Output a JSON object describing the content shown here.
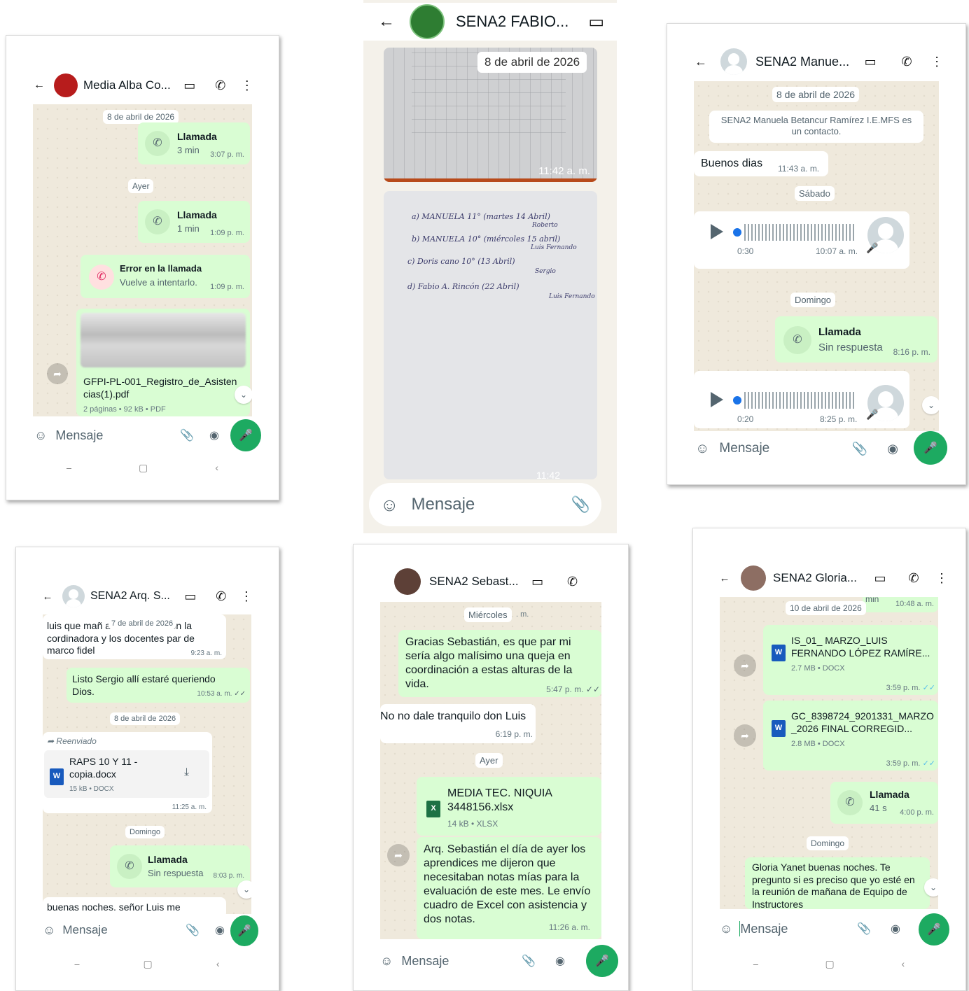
{
  "s1": {
    "title": "Media Alba Co...",
    "date_pill": "8 de abril de 2026",
    "call1": {
      "label": "Llamada",
      "duration": "3 min",
      "time": "3:07 p. m."
    },
    "yesterday_pill": "Ayer",
    "call2": {
      "label": "Llamada",
      "duration": "1 min",
      "time": "1:09 p. m."
    },
    "error": {
      "label": "Error en la llamada",
      "sub": "Vuelve a intentarlo.",
      "time": "1:09 p. m."
    },
    "doc": {
      "name": "GFPI-PL-001_Registro_de_Asistencias(1).pdf",
      "meta": "2 páginas • 92 kB • PDF"
    },
    "placeholder": "Mensaje"
  },
  "s2": {
    "title": "SENA2 FABIO...",
    "date_pill": "8 de abril de 2026",
    "img_time": "11:42 a. m.",
    "img_time2": "11:42",
    "notes": [
      "a) MANUELA   11°   (martes 14 Abril)",
      "Roberto",
      "b) MANUELA   10°   (miércoles 15 abril)",
      "Luis Fernando",
      "c) Doris cano  10°   (13 Abril)",
      "Sergio",
      "d) Fabio A. Rincón  (22 Abril)",
      "Luis Fernando"
    ],
    "placeholder": "Mensaje"
  },
  "s3": {
    "title": "SENA2 Manue...",
    "date_pill": "8 de abril de 2026",
    "contact_note": "SENA2 Manuela Betancur Ramírez I.E.MFS es un contacto.",
    "msg1": {
      "text": "Buenos dias",
      "time": "11:43 a. m."
    },
    "saturday_pill": "Sábado",
    "voice1": {
      "duration": "0:30",
      "time": "10:07 a. m."
    },
    "sunday_pill": "Domingo",
    "call": {
      "label": "Llamada",
      "sub": "Sin respuesta",
      "time": "8:16 p. m."
    },
    "voice2": {
      "duration": "0:20",
      "time": "8:25 p. m."
    },
    "placeholder": "Mensaje"
  },
  "s4": {
    "title": "SENA2 Arq. S...",
    "msg1": {
      "text": "luis que mañ  ara reunirnos con la cordinadora y los docentes par de marco fidel",
      "overlay_pill": "7 de abril de 2026",
      "time": "9:23 a. m."
    },
    "msg2": {
      "text": "Listo Sergio allí estaré queriendo Dios.",
      "time": "10:53 a. m."
    },
    "date_pill": "8 de abril de 2026",
    "forwarded": "Reenviado",
    "doc": {
      "name": "RAPS 10 Y 11 - copia.docx",
      "meta": "15 kB • DOCX",
      "time": "11:25 a. m."
    },
    "sunday_pill": "Domingo",
    "call": {
      "label": "Llamada",
      "sub": "Sin respuesta",
      "time": "8:03 p. m."
    },
    "msg3": "buenas noches. señor Luis me",
    "placeholder": "Mensaje"
  },
  "s5": {
    "title": "SENA2 Sebast...",
    "wed_pill": "Miércoles",
    "wed_time_frag": ". m.",
    "msg1": {
      "text": "Gracias Sebastián, es que par mi sería algo malísimo una queja en coordinación a estas alturas de la vida.",
      "time": "5:47 p. m."
    },
    "msg2": {
      "text": "No no dale tranquilo don Luis",
      "time": "6:19 p. m."
    },
    "yesterday_pill": "Ayer",
    "doc": {
      "name": "MEDIA TEC. NIQUIA 3448156.xlsx",
      "meta": "14 kB • XLSX"
    },
    "msg3": {
      "text": "Arq. Sebastián el día de ayer los aprendices me dijeron que necesitaban notas mías para la evaluación de este mes. Le envío cuadro de Excel con asistencia y dos notas.",
      "time": "11:26 a. m."
    },
    "placeholder": "Mensaje"
  },
  "s6": {
    "title": "SENA2 Gloria...",
    "top_frag": "min",
    "top_time": "10:48 a. m.",
    "date_pill": "10 de abril de 2026",
    "doc1": {
      "name": "IS_01_ MARZO_LUIS FERNANDO LÓPEZ RAMÍRE...",
      "meta": "2.7 MB • DOCX",
      "time": "3:59 p. m."
    },
    "doc2": {
      "name": "GC_8398724_9201331_MARZO_2026 FINAL CORREGID...",
      "meta": "2.8 MB • DOCX",
      "time": "3:59 p. m."
    },
    "call": {
      "label": "Llamada",
      "duration": "41 s",
      "time": "4:00 p. m."
    },
    "sunday_pill": "Domingo",
    "msg": "Gloria Yanet buenas noches. Te pregunto si es preciso que yo esté en la reunión de mañana de Equipo de Instructores",
    "placeholder": "Mensaje"
  },
  "icons": {
    "back": "←",
    "video": "▭",
    "phone": "✆",
    "more": "⋮",
    "clip": "📎",
    "camera": "◉",
    "mic": "🎤",
    "emoji": "☺",
    "forward": "➦",
    "down": "⌄",
    "download": "⤓",
    "w": "W",
    "x": "X"
  }
}
